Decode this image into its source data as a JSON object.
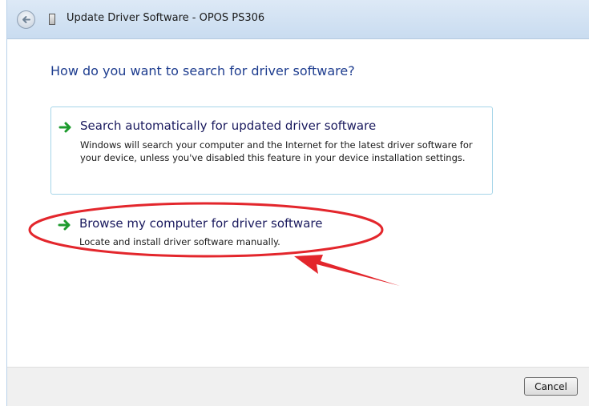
{
  "window": {
    "title": "Update Driver Software - OPOS PS306"
  },
  "main": {
    "heading": "How do you want to search for driver software?",
    "options": [
      {
        "title": "Search automatically for updated driver software",
        "description": "Windows will search your computer and the Internet for the latest driver software for your device, unless you've disabled this feature in your device installation settings.",
        "icon": "green-arrow-icon"
      },
      {
        "title": "Browse my computer for driver software",
        "description": "Locate and install driver software manually.",
        "icon": "green-arrow-icon"
      }
    ]
  },
  "footer": {
    "cancel_label": "Cancel"
  },
  "icons": {
    "back": "back-arrow-icon",
    "device": "device-icon"
  },
  "colors": {
    "heading": "#1e3d8f",
    "option_title": "#1a1a5e",
    "arrow_green": "#1e9b2e",
    "annotation_red": "#e3262c",
    "option_border": "#a5d5e8"
  }
}
